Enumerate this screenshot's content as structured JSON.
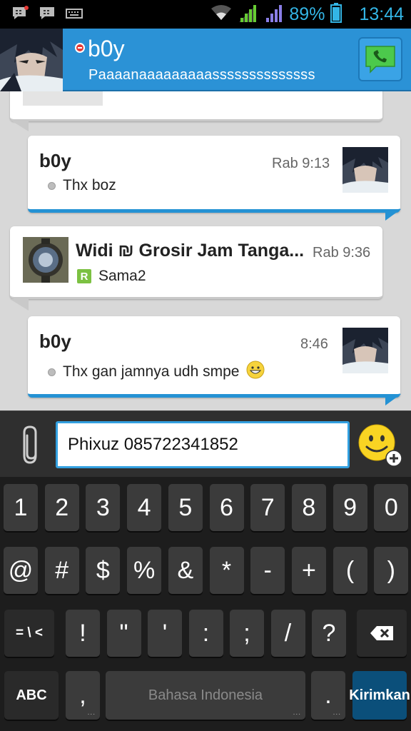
{
  "status_bar": {
    "battery": "89%",
    "time": "13:44",
    "icons": [
      "bbm-notification-icon",
      "bbm-icon",
      "keyboard-icon",
      "wifi-icon",
      "signal-icon",
      "signal-icon-2",
      "battery-icon"
    ]
  },
  "header": {
    "contact_name": "b0y",
    "contact_status": "Paaaanaaaaaaaaassssssssssssss",
    "status_color": "#e53935",
    "bg_color": "#2b92d6"
  },
  "messages": [
    {
      "sender": "b0y",
      "time": "Rab 9:13",
      "text": "Thx boz",
      "mine": true
    },
    {
      "sender": "Widi ₪ Grosir Jam Tanga...",
      "time": "Rab 9:36",
      "text": "Sama2",
      "mine": false
    },
    {
      "sender": "b0y",
      "time": "8:46",
      "text": "Thx gan jamnya udh smpe",
      "mine": true,
      "emoji": "grin-emoji"
    }
  ],
  "compose": {
    "value": "Phixuz 085722341852"
  },
  "keyboard": {
    "row1": [
      "1",
      "2",
      "3",
      "4",
      "5",
      "6",
      "7",
      "8",
      "9",
      "0"
    ],
    "row2": [
      "@",
      "#",
      "$",
      "%",
      "&",
      "*",
      "-",
      "+",
      "(",
      ")"
    ],
    "row3": [
      "= \\ <",
      "!",
      "\"",
      "'",
      ":",
      ";",
      "/",
      "?"
    ],
    "abc": "ABC",
    "comma": ",",
    "space": "Bahasa Indonesia",
    "period": ".",
    "send": "Kirimkan"
  }
}
